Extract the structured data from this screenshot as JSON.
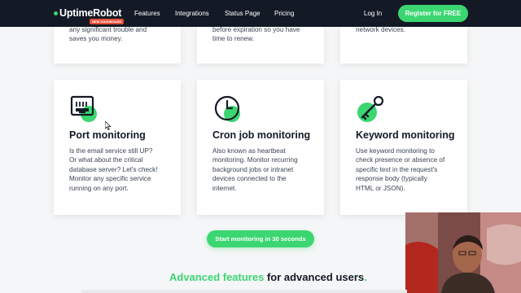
{
  "nav": {
    "logo": "UptimeRobot",
    "logo_badge": "NEW DASHBOARD",
    "links": [
      "Features",
      "Integrations",
      "Status Page",
      "Pricing"
    ],
    "login": "Log In",
    "register": "Register for FREE"
  },
  "top_cards": [
    {
      "lines": [
        "any significant trouble and",
        "saves you money."
      ]
    },
    {
      "lines": [
        "before expiration so you have",
        "time to renew."
      ]
    },
    {
      "lines": [
        "network devices."
      ]
    }
  ],
  "cards": [
    {
      "icon": "network-port-icon",
      "title": "Port monitoring",
      "lines": [
        "Is the email service still UP?",
        "Or what about the critical",
        "database server? Let's check!",
        "Monitor any specific service",
        "running on any port."
      ]
    },
    {
      "icon": "clock-icon",
      "title": "Cron job monitoring",
      "lines": [
        "Also known as heartbeat",
        "monitoring. Monitor recurring",
        "background jobs or intranet",
        "devices connected to the",
        "internet."
      ]
    },
    {
      "icon": "key-icon",
      "title": "Keyword monitoring",
      "lines": [
        "Use keyword monitoring to",
        "check presence or absence of",
        "specific text in the request's",
        "response body (typically",
        "HTML or JSON)."
      ]
    }
  ],
  "cta": "Start monitoring in 30 seconds",
  "advanced": {
    "highlight": "Advanced features",
    "rest": " for advanced users",
    "dot": "."
  },
  "colors": {
    "brand_green": "#3bd671",
    "nav_bg": "#131a26",
    "badge_red": "#e8503a"
  }
}
